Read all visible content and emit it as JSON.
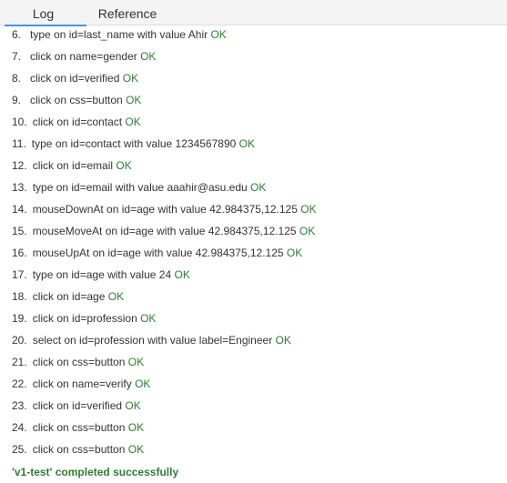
{
  "tabs": {
    "log": "Log",
    "reference": "Reference"
  },
  "log_entries": [
    {
      "num": "6.",
      "text": "type on id=last_name with value Ahir",
      "status": "OK"
    },
    {
      "num": "7.",
      "text": "click on name=gender",
      "status": "OK"
    },
    {
      "num": "8.",
      "text": "click on id=verified",
      "status": "OK"
    },
    {
      "num": "9.",
      "text": "click on css=button",
      "status": "OK"
    },
    {
      "num": "10.",
      "text": "click on id=contact",
      "status": "OK"
    },
    {
      "num": "11.",
      "text": "type on id=contact with value 1234567890",
      "status": "OK"
    },
    {
      "num": "12.",
      "text": "click on id=email",
      "status": "OK"
    },
    {
      "num": "13.",
      "text": "type on id=email with value aaahir@asu.edu",
      "status": "OK"
    },
    {
      "num": "14.",
      "text": "mouseDownAt on id=age with value 42.984375,12.125",
      "status": "OK"
    },
    {
      "num": "15.",
      "text": "mouseMoveAt on id=age with value 42.984375,12.125",
      "status": "OK"
    },
    {
      "num": "16.",
      "text": "mouseUpAt on id=age with value 42.984375,12.125",
      "status": "OK"
    },
    {
      "num": "17.",
      "text": "type on id=age with value 24",
      "status": "OK"
    },
    {
      "num": "18.",
      "text": "click on id=age",
      "status": "OK"
    },
    {
      "num": "19.",
      "text": "click on id=profession",
      "status": "OK"
    },
    {
      "num": "20.",
      "text": "select on id=profession with value label=Engineer",
      "status": "OK"
    },
    {
      "num": "21.",
      "text": "click on css=button",
      "status": "OK"
    },
    {
      "num": "22.",
      "text": "click on name=verify",
      "status": "OK"
    },
    {
      "num": "23.",
      "text": "click on id=verified",
      "status": "OK"
    },
    {
      "num": "24.",
      "text": "click on css=button",
      "status": "OK"
    },
    {
      "num": "25.",
      "text": "click on css=button",
      "status": "OK"
    }
  ],
  "completion_message": "'v1-test' completed successfully",
  "colors": {
    "ok": "#2e7d32",
    "tab_accent": "#4a90e2"
  }
}
